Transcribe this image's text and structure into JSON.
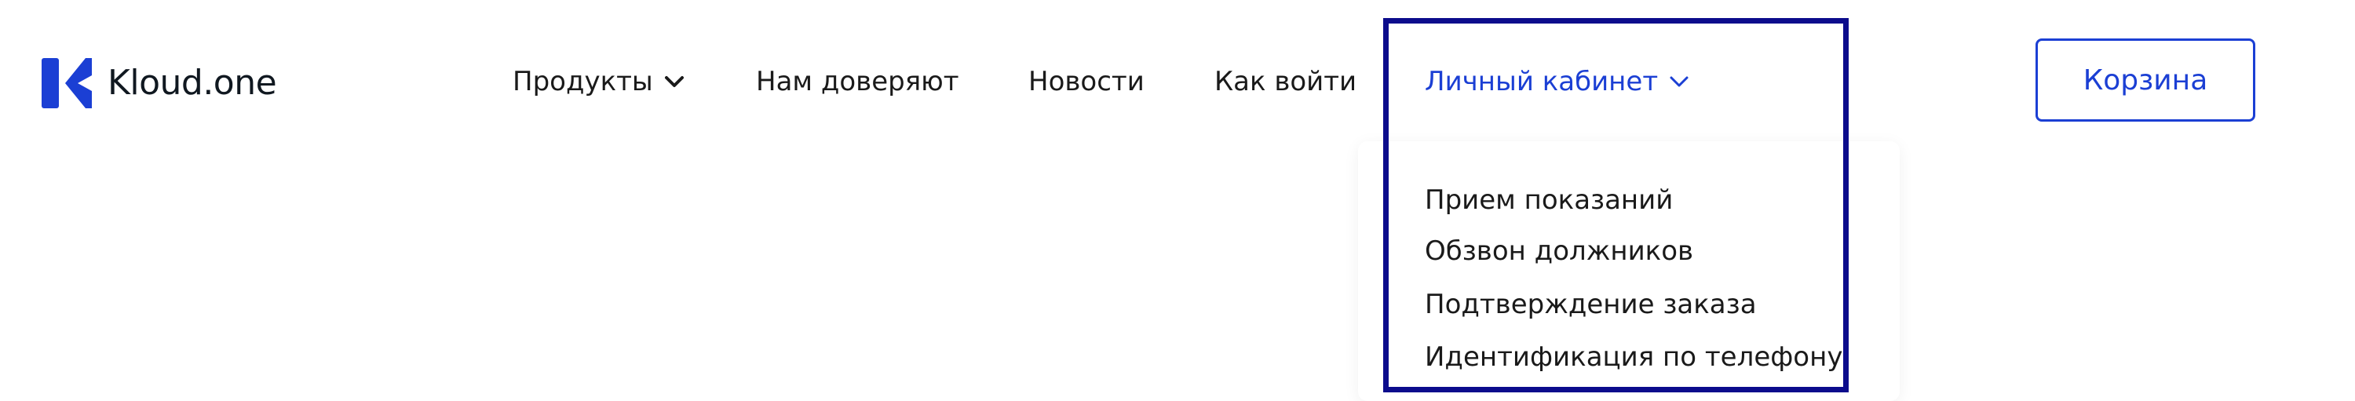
{
  "header": {
    "logo_text": "Kloud.one",
    "brand_color": "#1b3fd4",
    "nav": {
      "products": "Продукты",
      "trust": "Нам доверяют",
      "news": "Новости",
      "howto": "Как войти",
      "cabinet": "Личный кабинет"
    },
    "cart_label": "Корзина"
  },
  "dropdown": {
    "items": [
      "Прием показаний",
      "Обзвон должников",
      "Подтверждение заказа",
      "Идентификация по телефону"
    ]
  },
  "highlight_color": "#0c0c8c"
}
